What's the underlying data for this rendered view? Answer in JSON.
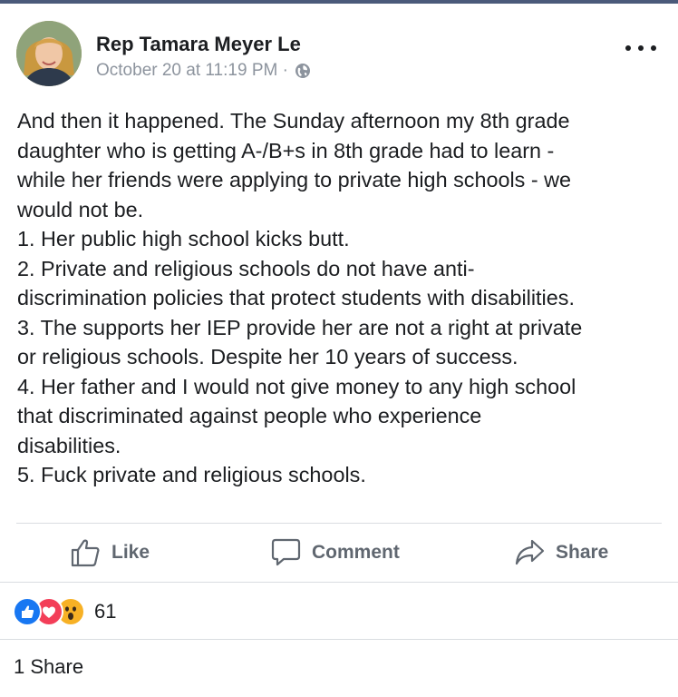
{
  "post": {
    "author": "Rep Tamara Meyer Le",
    "timestamp": "October 20 at 11:19 PM ·",
    "privacy_icon": "globe-icon",
    "more_icon": "more-options-icon",
    "body_lines": [
      "And then it happened. The Sunday afternoon my 8th grade",
      "daughter who is getting A-/B+s in 8th grade had to learn -",
      "while her friends were applying to private high schools - we",
      "would not be.",
      "1. Her public high school kicks butt.",
      "2. Private and religious schools do not have anti-",
      "discrimination policies that protect students with disabilities.",
      "3. The supports her IEP provide her are not a right at private",
      "or religious schools. Despite her 10 years of success.",
      "4. Her father and I would not give money to any high school",
      "that discriminated against people who experience",
      "disabilities.",
      "5. Fuck private and religious schools."
    ]
  },
  "actions": {
    "like_label": "Like",
    "comment_label": "Comment",
    "share_label": "Share"
  },
  "reactions": {
    "icons": [
      "like-reaction-icon",
      "love-reaction-icon",
      "wow-reaction-icon"
    ],
    "count": "61"
  },
  "shares": {
    "label": "1 Share"
  },
  "colors": {
    "like_blue": "#1877f2",
    "love_red": "#f33e58",
    "wow_yellow": "#f7b125",
    "muted_text": "#606770",
    "meta_text": "#8d949e"
  }
}
